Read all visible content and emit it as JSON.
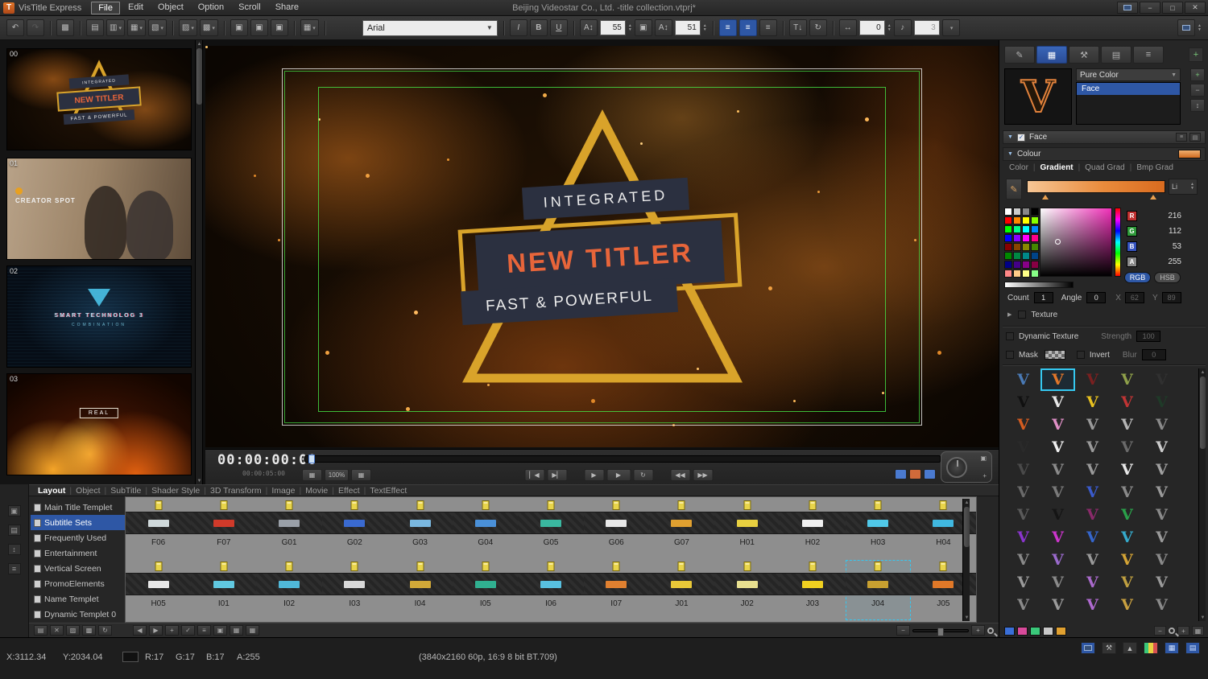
{
  "icons": {
    "minimize": "−",
    "maximize": "□",
    "close": "✕",
    "dropdown": "▾",
    "undo": "↶",
    "redo": "↷",
    "doc": "▤",
    "folder": "▥",
    "save": "▦",
    "save2": "▧",
    "import": "▨",
    "export": "▩",
    "link": "▣",
    "italic": "I",
    "bold": "B",
    "underline": "U",
    "char-height": "A↕",
    "char-width": "A↕",
    "lock": "▣",
    "align": "≡",
    "vert-text": "T↓",
    "rotate-text": "↻",
    "spacing": "↔",
    "speaker": "♪",
    "up": "▲",
    "down": "▼",
    "left": "◀",
    "right": "▶",
    "step-back": "▏◀",
    "step-fwd": "▶▏",
    "play": "▶",
    "loop": "↻",
    "go-start": "◀◀",
    "go-end": "▶▶",
    "plus": "+",
    "minus": "−",
    "list": "≡",
    "updown": "↕",
    "grid": "▦",
    "pen": "✎",
    "check": "✓",
    "expand": "▶",
    "collapse": "▼",
    "home": "▲",
    "wrench": "⚒",
    "target": "+",
    "camera": "▣"
  },
  "menubar": {
    "logo_letter": "T",
    "app_name": "VisTitle Express",
    "menus": [
      "File",
      "Edit",
      "Object",
      "Option",
      "Scroll",
      "Share"
    ],
    "active_menu": "File",
    "window_title": "Beijing Videostar Co., Ltd. -title collection.vtprj*"
  },
  "toolbar": {
    "font_name": "Arial",
    "font_size": "55",
    "tracking": "51",
    "kerning": "0",
    "opacity": "3"
  },
  "clip_list": [
    {
      "index": "00",
      "kind": "titler"
    },
    {
      "index": "01",
      "kind": "photo",
      "caption": "CREATOR SPOT"
    },
    {
      "index": "02",
      "kind": "tech",
      "caption": "SMART TECHNOLOG 3",
      "caption2": "COMBINATION"
    },
    {
      "index": "03",
      "kind": "fire",
      "caption": "REAL"
    }
  ],
  "preview": {
    "top_text": "INTEGRATED",
    "main_text": "NEW TITLER",
    "bottom_text": "FAST & POWERFUL"
  },
  "transport": {
    "timecode": "00:00:00:00",
    "duration": "00:00:05:00",
    "zoom": "100%"
  },
  "tabs": {
    "items": [
      "Layout",
      "Object",
      "SubTitle",
      "Shader Style",
      "3D Transform",
      "Image",
      "Movie",
      "Effect",
      "TextEffect"
    ],
    "active": "Layout"
  },
  "library": {
    "categories": [
      "Main Title Templet",
      "Subtitle Sets",
      "Frequently Used",
      "Entertainment",
      "Vertical Screen",
      "PromoElements",
      "Name Templet",
      "Dynamic Templet 0"
    ],
    "active_category": "Subtitle Sets",
    "selected_template": "J04",
    "rows": [
      [
        {
          "label": "F06",
          "accent": "#cfd8da"
        },
        {
          "label": "F07",
          "accent": "#d03a2a"
        },
        {
          "label": "G01",
          "accent": "#9aa0a8"
        },
        {
          "label": "G02",
          "accent": "#3a6ad0"
        },
        {
          "label": "G03",
          "accent": "#7ab8e0"
        },
        {
          "label": "G04",
          "accent": "#4a90d8"
        },
        {
          "label": "G05",
          "accent": "#3ab8a0"
        },
        {
          "label": "G06",
          "accent": "#e8e8e8"
        },
        {
          "label": "G07",
          "accent": "#e0a030"
        },
        {
          "label": "H01",
          "accent": "#e8d040"
        },
        {
          "label": "H02",
          "accent": "#f0f0f0"
        },
        {
          "label": "H03",
          "accent": "#50c8e8"
        },
        {
          "label": "H04",
          "accent": "#40b8e0"
        }
      ],
      [
        {
          "label": "H05",
          "accent": "#e8e8e8"
        },
        {
          "label": "I01",
          "accent": "#60c8e0"
        },
        {
          "label": "I02",
          "accent": "#50b8d8"
        },
        {
          "label": "I03",
          "accent": "#d8d8d8"
        },
        {
          "label": "I04",
          "accent": "#d0a838"
        },
        {
          "label": "I05",
          "accent": "#30b090"
        },
        {
          "label": "I06",
          "accent": "#58c0e0"
        },
        {
          "label": "I07",
          "accent": "#e08030"
        },
        {
          "label": "J01",
          "accent": "#e8c838"
        },
        {
          "label": "J02",
          "accent": "#e8e090"
        },
        {
          "label": "J03",
          "accent": "#f0d020"
        },
        {
          "label": "J04",
          "accent": "#c8a030"
        },
        {
          "label": "J05",
          "accent": "#e07828"
        }
      ]
    ]
  },
  "inspector": {
    "glyph": "V",
    "style_name": "Pure Color",
    "layers": [
      "Face"
    ],
    "selected_layer": "Face",
    "section_face": "Face",
    "section_colour": "Colour",
    "colour_modes": [
      "Color",
      "Gradient",
      "Quad Grad",
      "Bmp Grad"
    ],
    "active_colour_mode": "Gradient",
    "gradient_spinner": "Li",
    "channels": [
      {
        "label": "R",
        "value": "216",
        "chip": "#c03030"
      },
      {
        "label": "G",
        "value": "112",
        "chip": "#2f9a3a"
      },
      {
        "label": "B",
        "value": "53",
        "chip": "#3553c0"
      },
      {
        "label": "A",
        "value": "255",
        "chip": "#8a8a8a"
      }
    ],
    "mode_rgb": "RGB",
    "mode_hsb": "HSB",
    "count_label": "Count",
    "count": "1",
    "angle_label": "Angle",
    "angle": "0",
    "x_label": "X",
    "x": "62",
    "y_label": "Y",
    "y": "89",
    "texture_label": "Texture",
    "dynamic_texture_label": "Dynamic Texture",
    "strength_label": "Strength",
    "strength": "100",
    "mask_label": "Mask",
    "invert_label": "Invert",
    "blur_label": "Blur",
    "blur": "0",
    "palette": [
      "#ffffff",
      "#cccccc",
      "#888888",
      "#000000",
      "#ff0000",
      "#ff8800",
      "#ffff00",
      "#88ff00",
      "#00ff00",
      "#00ff88",
      "#00ffff",
      "#0088ff",
      "#0000ff",
      "#8800ff",
      "#ff00ff",
      "#ff0088",
      "#880000",
      "#884400",
      "#888800",
      "#448800",
      "#008800",
      "#008844",
      "#008888",
      "#004488",
      "#000088",
      "#440088",
      "#880088",
      "#880044",
      "#ff8888",
      "#ffcc88",
      "#ffff88",
      "#88ff88"
    ],
    "glyph_grid": [
      [
        "#4a7ab5",
        "#e0762a",
        "#7a2020",
        "#8fa04a",
        "#303030"
      ],
      [
        "#101010",
        "#e8e8e8",
        "#e8c11f",
        "#c03434",
        "#1f3a28"
      ],
      [
        "#d45c20",
        "#df8fc5",
        "#9a9a9a",
        "#b5b5b5",
        "#8a8a8a"
      ],
      [
        "#2a2a2a",
        "#f0f0f0",
        "#9a9a9a",
        "#6a6a6a",
        "#cccccc"
      ],
      [
        "#4a4a4a",
        "#8a8a8a",
        "#9a9a9a",
        "#e8e8e8",
        "#a0a0a0"
      ],
      [
        "#6a6a6a",
        "#7a7a7a",
        "#3a5acc",
        "#8a8a8a",
        "#9a9a9a"
      ],
      [
        "#5a5a5a",
        "#151515",
        "#8a2a6a",
        "#2aa04a",
        "#8a8a8a"
      ],
      [
        "#8a35cc",
        "#cc35cc",
        "#3566cc",
        "#35aacc",
        "#9a9a9a"
      ],
      [
        "#8a8a8a",
        "#9a6acc",
        "#9a9a9a",
        "#d4a435",
        "#8a8a8a"
      ],
      [
        "#9a9a9a",
        "#8a8a8a",
        "#aa6acc",
        "#c0a040",
        "#9a9a9a"
      ],
      [
        "#8a8a8a",
        "#9a9a9a",
        "#b06ad0",
        "#c8a040",
        "#8a8a8a"
      ]
    ],
    "selected_glyph": {
      "row": 0,
      "col": 1
    }
  },
  "status": {
    "x": "X:3112.34",
    "y": "Y:2034.04",
    "r": "R:17",
    "g": "G:17",
    "b": "B:17",
    "a": "A:255",
    "format": "(3840x2160 60p, 16:9 8 bit BT.709)"
  }
}
